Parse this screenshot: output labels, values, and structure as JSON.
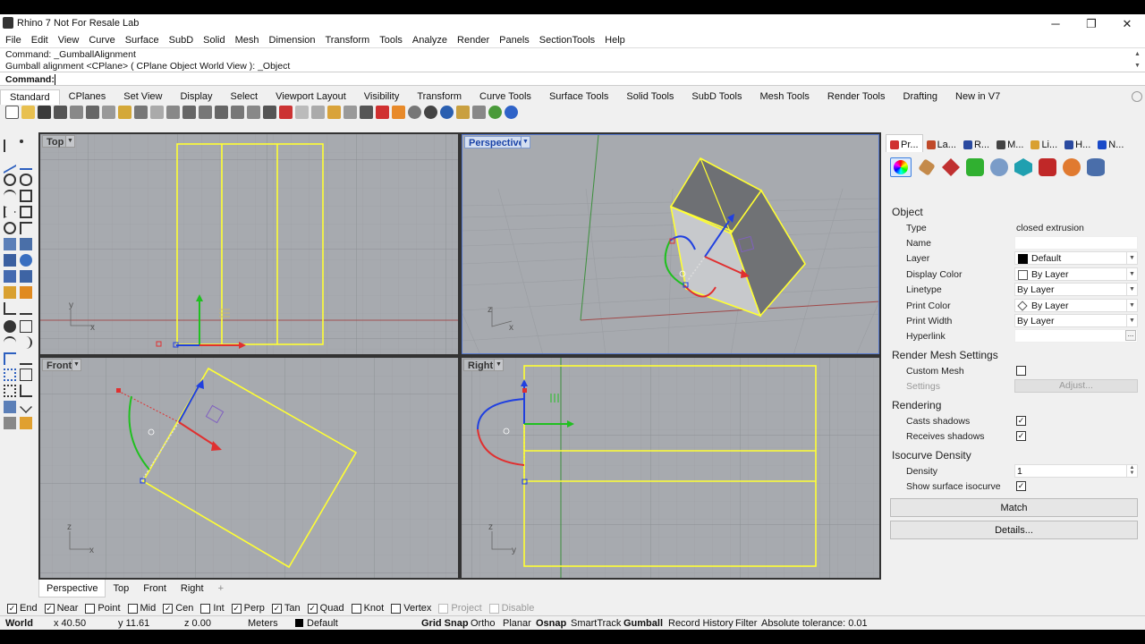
{
  "window": {
    "title": "Rhino 7 Not For Resale Lab",
    "minimize": "─",
    "maximize": "❐",
    "close": "✕"
  },
  "menu": [
    "File",
    "Edit",
    "View",
    "Curve",
    "Surface",
    "SubD",
    "Solid",
    "Mesh",
    "Dimension",
    "Transform",
    "Tools",
    "Analyze",
    "Render",
    "Panels",
    "SectionTools",
    "Help"
  ],
  "command_history": [
    "Command: _GumballAlignment",
    "Gumball alignment <CPlane> ( CPlane  Object  World  View ): _Object"
  ],
  "command_prompt": {
    "label": "Command:",
    "value": ""
  },
  "toolbar_tabs": [
    "Standard",
    "CPlanes",
    "Set View",
    "Display",
    "Select",
    "Viewport Layout",
    "Visibility",
    "Transform",
    "Curve Tools",
    "Surface Tools",
    "Solid Tools",
    "SubD Tools",
    "Mesh Tools",
    "Render Tools",
    "Drafting",
    "New in V7"
  ],
  "viewports": {
    "top": {
      "label": "Top",
      "x_axis": "x",
      "y_axis": "y"
    },
    "perspective": {
      "label": "Perspective",
      "x_axis": "x",
      "z_axis": "z"
    },
    "front": {
      "label": "Front",
      "x_axis": "x",
      "z_axis": "z"
    },
    "right": {
      "label": "Right",
      "y_axis": "y",
      "z_axis": "z"
    }
  },
  "viewport_tabs": [
    "Perspective",
    "Top",
    "Front",
    "Right",
    "+"
  ],
  "properties_panel": {
    "tabs": [
      "Pr...",
      "La...",
      "R...",
      "M...",
      "Li...",
      "H...",
      "N..."
    ],
    "sections": {
      "object": "Object",
      "render_mesh": "Render Mesh Settings",
      "rendering": "Rendering",
      "isocurve": "Isocurve Density"
    },
    "object_rows": [
      {
        "label": "Type",
        "value": "closed extrusion"
      },
      {
        "label": "Name",
        "value": ""
      },
      {
        "label": "Layer",
        "value": "Default"
      },
      {
        "label": "Display Color",
        "value": "By Layer"
      },
      {
        "label": "Linetype",
        "value": "By Layer"
      },
      {
        "label": "Print Color",
        "value": "By Layer"
      },
      {
        "label": "Print Width",
        "value": "By Layer"
      },
      {
        "label": "Hyperlink",
        "value": "..."
      }
    ],
    "custom_mesh": {
      "label": "Custom Mesh",
      "checked": false
    },
    "settings": {
      "label": "Settings",
      "button": "Adjust..."
    },
    "casts_shadows": {
      "label": "Casts shadows",
      "checked": true
    },
    "receives_shadows": {
      "label": "Receives shadows",
      "checked": true
    },
    "density": {
      "label": "Density",
      "value": "1"
    },
    "show_isocurve": {
      "label": "Show surface isocurve",
      "checked": true
    },
    "match_button": "Match",
    "details_button": "Details..."
  },
  "osnaps": [
    {
      "label": "End",
      "checked": true
    },
    {
      "label": "Near",
      "checked": true
    },
    {
      "label": "Point",
      "checked": false
    },
    {
      "label": "Mid",
      "checked": false
    },
    {
      "label": "Cen",
      "checked": true
    },
    {
      "label": "Int",
      "checked": false
    },
    {
      "label": "Perp",
      "checked": true
    },
    {
      "label": "Tan",
      "checked": true
    },
    {
      "label": "Quad",
      "checked": true
    },
    {
      "label": "Knot",
      "checked": false
    },
    {
      "label": "Vertex",
      "checked": false
    },
    {
      "label": "Project",
      "checked": false,
      "disabled": true
    },
    {
      "label": "Disable",
      "checked": false,
      "disabled": true
    }
  ],
  "status": {
    "cplane": "World",
    "x": "x 40.50",
    "y": "y 11.61",
    "z": "z 0.00",
    "units": "Meters",
    "layer": "Default",
    "grid_snap": "Grid Snap",
    "ortho": "Ortho",
    "planar": "Planar",
    "osnap": "Osnap",
    "smarttrack": "SmartTrack",
    "gumball": "Gumball",
    "record_history": "Record History",
    "filter": "Filter",
    "tolerance": "Absolute tolerance: 0.01"
  },
  "colors": {
    "selection": "#ffff33",
    "x_axis": "#e03030",
    "y_axis": "#20c020",
    "z_axis": "#2040e0",
    "viewport_bg": "#a7aaaf",
    "active_label": "#1a43a8"
  }
}
